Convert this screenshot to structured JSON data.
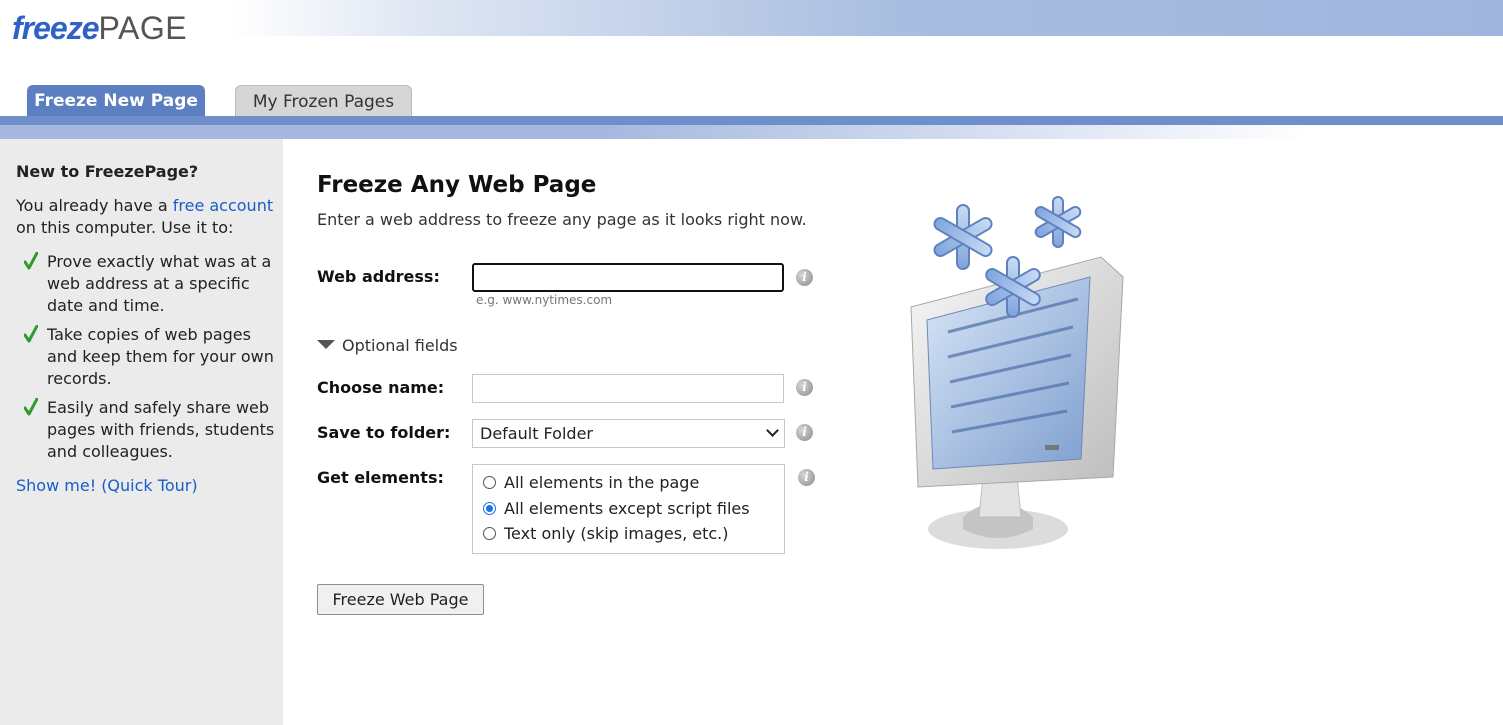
{
  "brand": {
    "logo_part1": "freeze",
    "logo_part2": "PAGE"
  },
  "tabs": [
    {
      "label": "Freeze New Page",
      "active": true
    },
    {
      "label": "My Frozen Pages",
      "active": false
    }
  ],
  "sidebar": {
    "heading": "New to FreezePage?",
    "intro_prefix": "You already have a ",
    "intro_link": "free account",
    "intro_suffix": " on this computer. Use it to:",
    "items": [
      {
        "text": "Prove exactly what was at a web address at a specific date and time."
      },
      {
        "text": "Take copies of web pages and keep them for your own records."
      },
      {
        "text": "Easily and safely share web pages with friends, students and colleagues."
      }
    ],
    "tour_link": "Show me! (Quick Tour)"
  },
  "main": {
    "title": "Freeze Any Web Page",
    "subtitle": "Enter a web address to freeze any page as it looks right now.",
    "web_address": {
      "label": "Web address:",
      "value": "",
      "hint": "e.g. www.nytimes.com"
    },
    "optional_fields": "Optional fields",
    "choose_name": {
      "label": "Choose name:",
      "value": ""
    },
    "save_to_folder": {
      "label": "Save to folder:",
      "selected": "Default Folder"
    },
    "get_elements": {
      "label": "Get elements:",
      "options": [
        {
          "label": "All elements in the page",
          "selected": false
        },
        {
          "label": "All elements except script files",
          "selected": true
        },
        {
          "label": "Text only (skip images, etc.)",
          "selected": false
        }
      ]
    },
    "submit_label": "Freeze Web Page"
  },
  "info_icon_glyph": "i",
  "colors": {
    "brand_blue": "#2f61c6",
    "tab_active": "#5c7fc2",
    "band_dark": "#6f8fca",
    "link": "#1a5ccc",
    "check_green": "#2e9b2e",
    "sidebar_bg": "#ebebeb"
  },
  "icons": {
    "check": "check-icon",
    "info": "info-icon",
    "illustration": "frozen-monitor-illustration"
  }
}
